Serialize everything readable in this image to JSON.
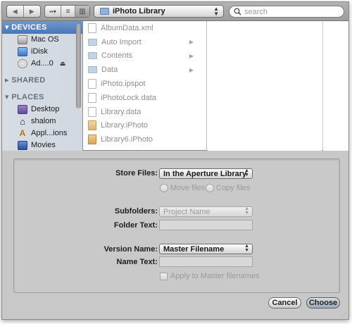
{
  "toolbar": {
    "back_icon": "left-arrow",
    "forward_icon": "right-arrow",
    "view_icons": [
      "icon-view",
      "list-view",
      "column-view"
    ],
    "path_popup": "iPhoto Library",
    "search_placeholder": "search"
  },
  "sidebar": {
    "sections": [
      {
        "label": "DEVICES",
        "expanded": true,
        "selected": true,
        "items": [
          {
            "label": "Mac OS",
            "icon": "hard-drive-icon"
          },
          {
            "label": "iDisk",
            "icon": "idisk-icon"
          },
          {
            "label": "Ad....0",
            "icon": "disc-icon",
            "eject": true
          }
        ]
      },
      {
        "label": "SHARED",
        "expanded": false,
        "items": []
      },
      {
        "label": "PLACES",
        "expanded": true,
        "items": [
          {
            "label": "Desktop",
            "icon": "desktop-icon"
          },
          {
            "label": "shalom",
            "icon": "home-icon"
          },
          {
            "label": "Appl...ions",
            "icon": "applications-icon"
          },
          {
            "label": "Movies",
            "icon": "movies-icon"
          }
        ]
      }
    ]
  },
  "files": [
    {
      "name": "AlbumData.xml",
      "kind": "file"
    },
    {
      "name": "Auto Import",
      "kind": "folder",
      "has_children": true
    },
    {
      "name": "Contents",
      "kind": "folder",
      "has_children": true
    },
    {
      "name": "Data",
      "kind": "folder",
      "has_children": true
    },
    {
      "name": "iPhoto.ipspot",
      "kind": "file"
    },
    {
      "name": "iPhotoLock.data",
      "kind": "file"
    },
    {
      "name": "Library.data",
      "kind": "file"
    },
    {
      "name": "Library.iPhoto",
      "kind": "package"
    },
    {
      "name": "Library6.iPhoto",
      "kind": "package"
    }
  ],
  "options": {
    "store_files_label": "Store Files:",
    "store_files_value": "In the Aperture Library",
    "move_files_label": "Move files",
    "copy_files_label": "Copy files",
    "subfolders_label": "Subfolders:",
    "subfolders_value": "Project Name",
    "folder_text_label": "Folder Text:",
    "version_name_label": "Version Name:",
    "version_name_value": "Master Filename",
    "name_text_label": "Name Text:",
    "apply_label": "Apply to Master filenames"
  },
  "buttons": {
    "cancel": "Cancel",
    "choose": "Choose"
  }
}
